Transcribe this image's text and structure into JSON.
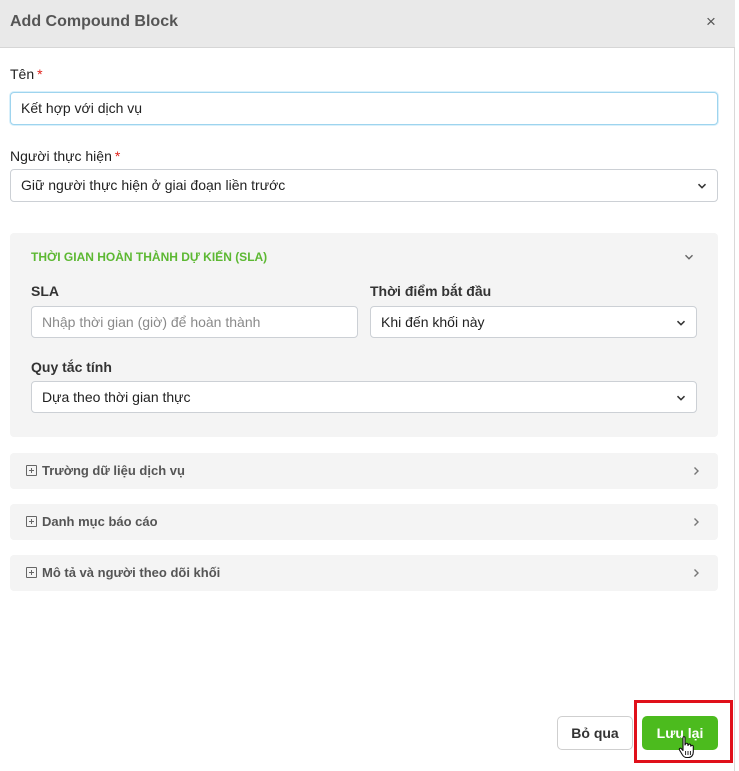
{
  "dialog": {
    "title": "Add Compound Block",
    "close_glyph": "×"
  },
  "form": {
    "name": {
      "label": "Tên",
      "required_mark": "*",
      "value": "Kết hợp với dịch vụ"
    },
    "assignee": {
      "label": "Người thực hiện",
      "required_mark": "*",
      "value": "Giữ người thực hiện ở giai đoạn liền trước"
    }
  },
  "sla_section": {
    "title": "THỜI GIAN HOÀN THÀNH DỰ KIẾN (SLA)",
    "expanded": true,
    "sla": {
      "label": "SLA",
      "placeholder": "Nhập thời gian (giờ) để hoàn thành",
      "value": ""
    },
    "start_time": {
      "label": "Thời điểm bắt đầu",
      "value": "Khi đến khối này"
    },
    "calc_rule": {
      "label": "Quy tắc tính",
      "value": "Dựa theo thời gian thực"
    }
  },
  "collapsible_sections": [
    {
      "label": "Trường dữ liệu dịch vụ",
      "expanded": false
    },
    {
      "label": "Danh mục báo cáo",
      "expanded": false
    },
    {
      "label": "Mô tả và người theo dõi khối",
      "expanded": false
    }
  ],
  "footer": {
    "cancel_label": "Bỏ qua",
    "save_label": "Lưu lại"
  },
  "colors": {
    "accent_green": "#4cbb1e",
    "sla_title_green": "#5cb832",
    "required_red": "#e0201a",
    "highlight_red": "#e0101a"
  },
  "icons": {
    "close": "close-icon",
    "dropdown": "chevron-down-icon",
    "section_expand": "chevron-right-icon",
    "section_toggle": "plus-square-icon",
    "cursor": "hand-pointer-icon"
  }
}
